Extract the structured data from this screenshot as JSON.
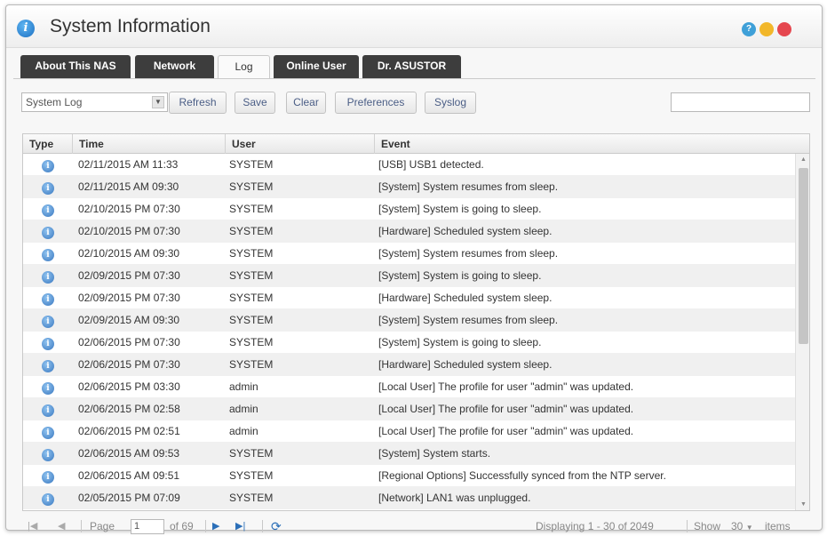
{
  "window": {
    "title": "System Information",
    "help_glyph": "?",
    "title_glyph": "i"
  },
  "tabs": [
    {
      "label": "About This NAS"
    },
    {
      "label": "Network"
    },
    {
      "label": "Log",
      "active": true
    },
    {
      "label": "Online User"
    },
    {
      "label": "Dr. ASUSTOR"
    }
  ],
  "toolbar": {
    "log_select_value": "System Log",
    "refresh_label": "Refresh",
    "save_label": "Save",
    "clear_label": "Clear",
    "preferences_label": "Preferences",
    "syslog_label": "Syslog",
    "search_value": ""
  },
  "grid": {
    "columns": [
      "Type",
      "Time",
      "User",
      "Event"
    ],
    "info_glyph": "i",
    "rows": [
      {
        "type": "info-icon",
        "time": "02/11/2015 AM 11:33",
        "user": "SYSTEM",
        "event": "[USB] USB1 detected."
      },
      {
        "type": "info-icon",
        "time": "02/11/2015 AM 09:30",
        "user": "SYSTEM",
        "event": "[System] System resumes from sleep."
      },
      {
        "type": "info-icon",
        "time": "02/10/2015 PM 07:30",
        "user": "SYSTEM",
        "event": "[System] System is going to sleep."
      },
      {
        "type": "info-icon",
        "time": "02/10/2015 PM 07:30",
        "user": "SYSTEM",
        "event": "[Hardware] Scheduled system sleep."
      },
      {
        "type": "info-icon",
        "time": "02/10/2015 AM 09:30",
        "user": "SYSTEM",
        "event": "[System] System resumes from sleep."
      },
      {
        "type": "info-icon",
        "time": "02/09/2015 PM 07:30",
        "user": "SYSTEM",
        "event": "[System] System is going to sleep."
      },
      {
        "type": "info-icon",
        "time": "02/09/2015 PM 07:30",
        "user": "SYSTEM",
        "event": "[Hardware] Scheduled system sleep."
      },
      {
        "type": "info-icon",
        "time": "02/09/2015 AM 09:30",
        "user": "SYSTEM",
        "event": "[System] System resumes from sleep."
      },
      {
        "type": "info-icon",
        "time": "02/06/2015 PM 07:30",
        "user": "SYSTEM",
        "event": "[System] System is going to sleep."
      },
      {
        "type": "info-icon",
        "time": "02/06/2015 PM 07:30",
        "user": "SYSTEM",
        "event": "[Hardware] Scheduled system sleep."
      },
      {
        "type": "info-icon",
        "time": "02/06/2015 PM 03:30",
        "user": "admin",
        "event": "[Local User] The profile for user \"admin\" was updated."
      },
      {
        "type": "info-icon",
        "time": "02/06/2015 PM 02:58",
        "user": "admin",
        "event": "[Local User] The profile for user \"admin\" was updated."
      },
      {
        "type": "info-icon",
        "time": "02/06/2015 PM 02:51",
        "user": "admin",
        "event": "[Local User] The profile for user \"admin\" was updated."
      },
      {
        "type": "info-icon",
        "time": "02/06/2015 AM 09:53",
        "user": "SYSTEM",
        "event": "[System] System starts."
      },
      {
        "type": "info-icon",
        "time": "02/06/2015 AM 09:51",
        "user": "SYSTEM",
        "event": "[Regional Options] Successfully synced from the NTP server."
      },
      {
        "type": "info-icon",
        "time": "02/05/2015 PM 07:09",
        "user": "SYSTEM",
        "event": "[Network] LAN1 was unplugged."
      }
    ]
  },
  "pager": {
    "page_label": "Page",
    "page_value": "1",
    "of_pages": "of 69",
    "displaying": "Displaying 1 - 30 of 2049",
    "show_label": "Show",
    "per_page": "30",
    "items_label": "items"
  },
  "colors": {
    "tab_bg": "#3d3d3d",
    "button_text": "#4a5d85",
    "info_blue": "#3a78c0",
    "close": "#e5474f",
    "minimize": "#f2b72a",
    "help": "#3fa0d8"
  }
}
